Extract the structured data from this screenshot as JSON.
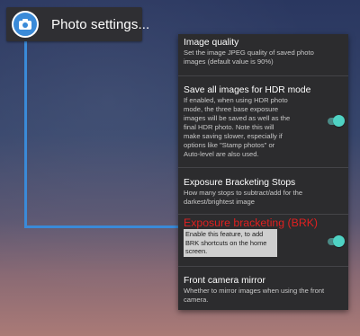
{
  "chip": {
    "label": "Photo settings..."
  },
  "panel": {
    "items": [
      {
        "title": "Image quality",
        "description": "Set the image JPEG quality of saved photo images (default value is 90%)"
      },
      {
        "title": "Save all images for HDR mode",
        "description": "If enabled, when using HDR photo mode, the three base exposure images will be saved as well as the final HDR photo. Note this will make saving slower, especially if options like \"Stamp photos\" or Auto-level are also used.",
        "toggle_on": true
      },
      {
        "title": "Exposure Bracketing Stops",
        "description": "How many stops to subtract/add for the darkest/brightest image"
      },
      {
        "title": "Exposure bracketing (BRK)",
        "description": "Enable this feature, to add BRK shortcuts on the home screen.",
        "toggle_on": true
      },
      {
        "title": "Front camera mirror",
        "description": "Whether to mirror images when using the front camera."
      }
    ]
  },
  "colors": {
    "accent_blue": "#3a8ad8",
    "highlight_red": "#e02020",
    "toggle_on": "#4fd3c4",
    "panel_bg": "#2c2c2e"
  },
  "icons": {
    "chip_icon": "camera-icon"
  }
}
